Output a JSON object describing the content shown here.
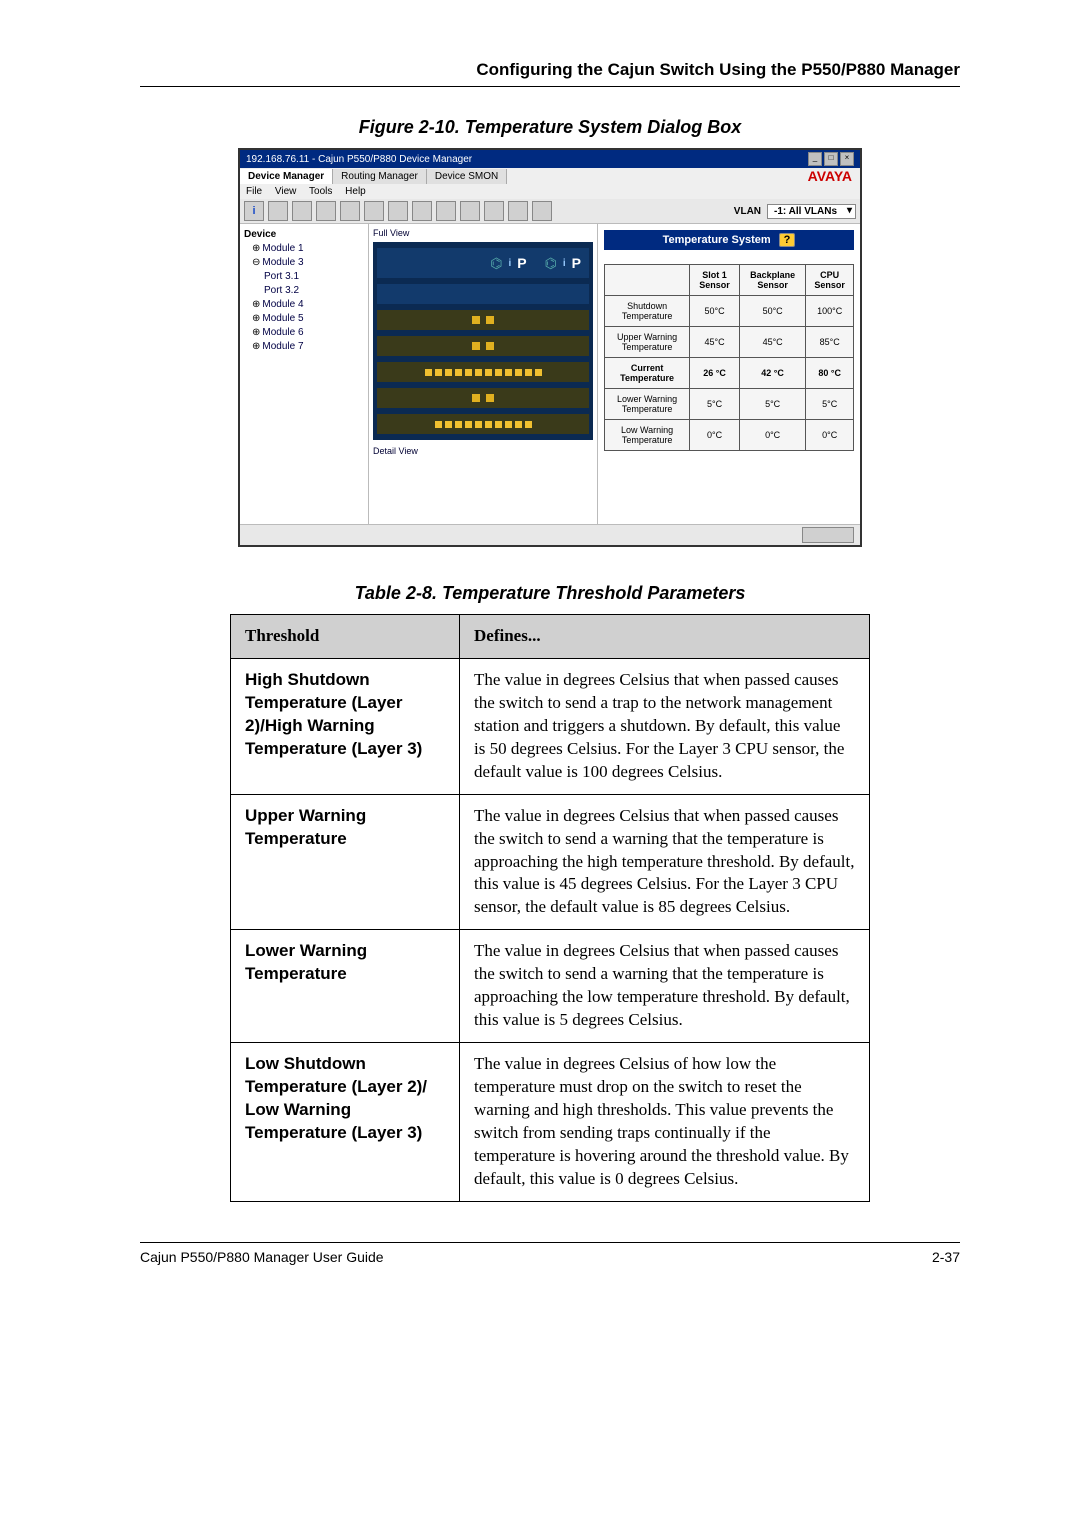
{
  "running_head": "Configuring the Cajun Switch Using the P550/P880 Manager",
  "figure_caption": "Figure 2-10.  Temperature System Dialog Box",
  "table_caption": "Table 2-8.  Temperature Threshold Parameters",
  "footer_left": "Cajun P550/P880 Manager User Guide",
  "footer_right": "2-37",
  "screenshot": {
    "title": "192.168.76.11 - Cajun P550/P880 Device Manager",
    "brand": "AVAYA",
    "tabs": [
      "Device Manager",
      "Routing Manager",
      "Device SMON"
    ],
    "menubar": [
      "File",
      "View",
      "Tools",
      "Help"
    ],
    "toolbar_icon_i": "i",
    "vlan_label": "VLAN",
    "vlan_value": "-1: All VLANs",
    "tree": {
      "root": "Device",
      "modules": [
        {
          "label": "Module 1",
          "exp": "⊕"
        },
        {
          "label": "Module 3",
          "exp": "⊖",
          "ports": [
            "Port 3.1",
            "Port 3.2"
          ]
        },
        {
          "label": "Module 4",
          "exp": "⊕"
        },
        {
          "label": "Module 5",
          "exp": "⊕"
        },
        {
          "label": "Module 6",
          "exp": "⊕"
        },
        {
          "label": "Module 7",
          "exp": "⊕"
        }
      ]
    },
    "fullview_label": "Full View",
    "detailview_label": "Detail View",
    "right_panel_title": "Temperature System",
    "right_panel_help": "?",
    "temp_table": {
      "headers": [
        "",
        "Slot 1 Sensor",
        "Backplane Sensor",
        "CPU Sensor"
      ],
      "rows": [
        {
          "label": "Shutdown Temperature",
          "cells": [
            "50°C",
            "50°C",
            "100°C"
          ]
        },
        {
          "label": "Upper Warning Temperature",
          "cells": [
            "45°C",
            "45°C",
            "85°C"
          ]
        },
        {
          "label": "Current Temperature",
          "cells": [
            "26 °C",
            "42 °C",
            "80 °C"
          ],
          "bold": true
        },
        {
          "label": "Lower Warning Temperature",
          "cells": [
            "5°C",
            "5°C",
            "5°C"
          ]
        },
        {
          "label": "Low Warning Temperature",
          "cells": [
            "0°C",
            "0°C",
            "0°C"
          ]
        }
      ]
    }
  },
  "params_table": {
    "head_threshold": "Threshold",
    "head_defines": "Defines...",
    "rows": [
      {
        "label": "High Shutdown Temperature (Layer 2)/High Warning Temperature (Layer 3)",
        "desc": "The value in degrees Celsius that when passed causes the switch to send a trap to the network management station and triggers a shutdown. By default, this value is 50 degrees Celsius. For the Layer 3 CPU sensor, the default value is 100 degrees Celsius."
      },
      {
        "label": "Upper Warning Temperature",
        "desc": "The value in degrees Celsius that when passed causes the switch to send a warning that the temperature is approaching the high temperature threshold. By default, this value is 45 degrees Celsius. For the Layer 3 CPU sensor, the default value is 85 degrees Celsius."
      },
      {
        "label": "Lower Warning Temperature",
        "desc": "The value in degrees Celsius that when passed causes the switch to send a warning that the temperature is approaching the low temperature threshold. By default, this value is 5 degrees Celsius."
      },
      {
        "label": "Low Shutdown Temperature (Layer 2)/ Low Warning Temperature (Layer 3)",
        "desc": "The value in degrees Celsius of how low the temperature must drop on the switch to reset the warning and high thresholds. This value prevents the switch from sending traps continually if the temperature is hovering around the threshold value. By default, this value is 0 degrees Celsius."
      }
    ]
  }
}
